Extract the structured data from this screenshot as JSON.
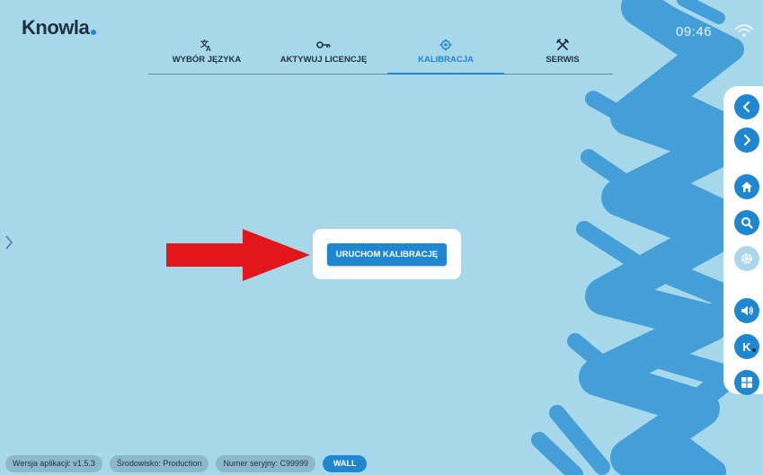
{
  "brand": {
    "name": "Knowla"
  },
  "status": {
    "time": "09:46",
    "wifi_icon": "wifi-icon"
  },
  "tabs": [
    {
      "label": "WYBÓR JĘZYKA",
      "icon": "translate-icon",
      "active": false
    },
    {
      "label": "AKTYWUJ LICENCJĘ",
      "icon": "key-icon",
      "active": false
    },
    {
      "label": "KALIBRACJA",
      "icon": "target-icon",
      "active": true
    },
    {
      "label": "SERWIS",
      "icon": "tools-icon",
      "active": false
    }
  ],
  "main": {
    "start_button": "URUCHOM KALIBRACJĘ",
    "arrow_color": "#e3161b"
  },
  "sidebar": {
    "items": [
      {
        "name": "back",
        "icon": "chevron-left-icon"
      },
      {
        "name": "forward",
        "icon": "chevron-right-icon"
      },
      {
        "name": "home",
        "icon": "home-icon"
      },
      {
        "name": "search",
        "icon": "search-icon"
      },
      {
        "name": "settings",
        "icon": "gear-icon",
        "disabled": true
      },
      {
        "name": "volume",
        "icon": "speaker-icon"
      },
      {
        "name": "knowla",
        "icon": "knowla-k-icon",
        "label": "K"
      },
      {
        "name": "windows",
        "icon": "windows-icon"
      }
    ]
  },
  "footer": {
    "version": "Wersja aplikacji: v1.5.3",
    "environment": "Środowisko: Production",
    "serial": "Numer seryjny: C99999",
    "mode": "WALL"
  },
  "colors": {
    "accent": "#1f86d0",
    "background": "#a6d8ea",
    "decoration": "#3f9bd6",
    "text": "#1e3142"
  }
}
